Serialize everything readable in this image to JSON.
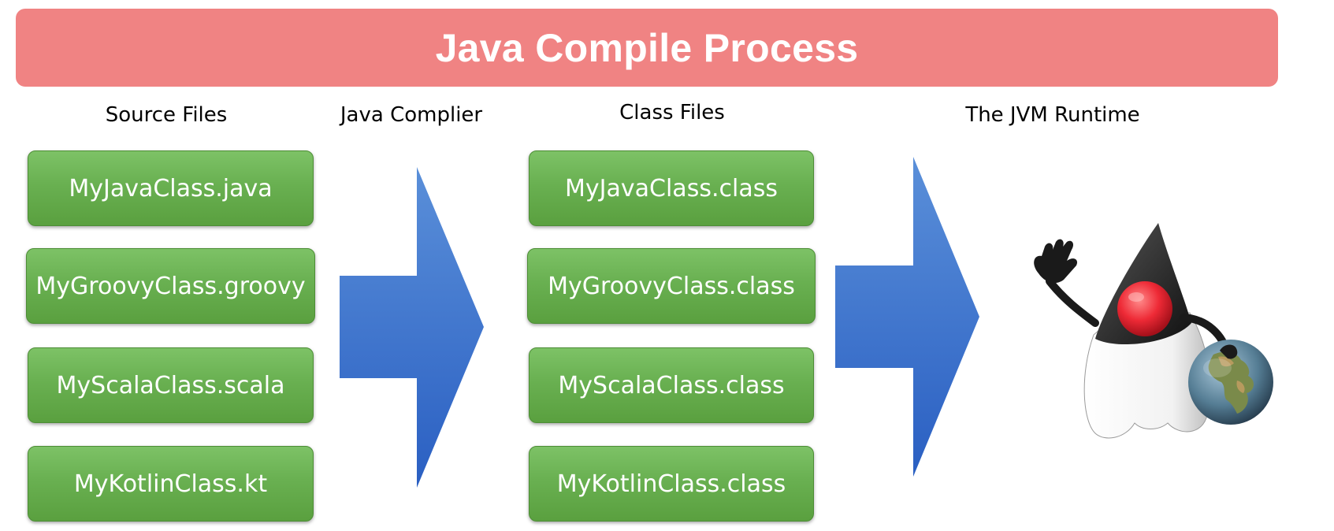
{
  "title": "Java Compile Process",
  "columns": {
    "source": "Source Files",
    "compiler": "Java Complier",
    "class": "Class Files",
    "runtime": "The JVM Runtime"
  },
  "source_files": [
    "MyJavaClass.java",
    "MyGroovyClass.groovy",
    "MyScalaClass.scala",
    "MyKotlinClass.kt"
  ],
  "class_files": [
    "MyJavaClass.class",
    "MyGroovyClass.class",
    "MyScalaClass.class",
    "MyKotlinClass.class"
  ],
  "colors": {
    "banner": "#f08383",
    "box": "#69b051",
    "arrow_light": "#4f86d6",
    "arrow_dark": "#2e63c4"
  },
  "icons": [
    "duke-mascot-icon",
    "globe-icon"
  ]
}
